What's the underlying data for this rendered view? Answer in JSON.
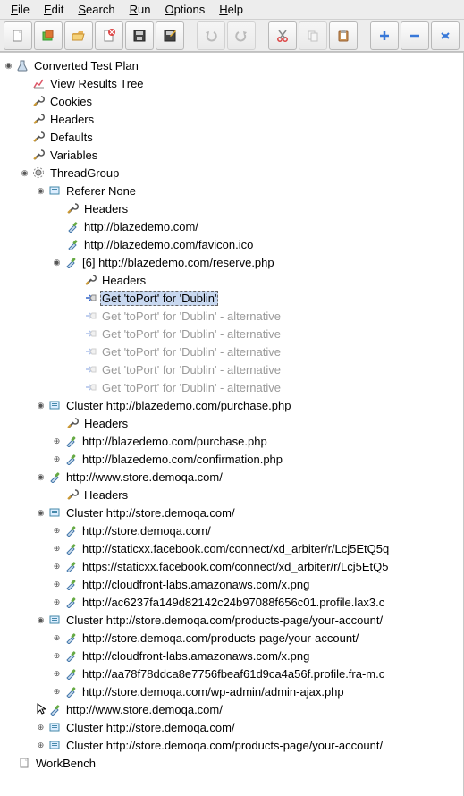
{
  "menu": {
    "file": "File",
    "edit": "Edit",
    "search": "Search",
    "run": "Run",
    "options": "Options",
    "help": "Help"
  },
  "toolbar": {
    "new": "new",
    "templates": "templates",
    "open": "open",
    "close": "close",
    "save": "save",
    "saveas": "save-as",
    "undo": "undo",
    "redo": "redo",
    "cut": "cut",
    "copy": "copy",
    "paste": "paste",
    "expand": "expand",
    "collapse": "collapse",
    "toggle": "toggle"
  },
  "tree": {
    "root": "Converted Test Plan",
    "viewResults": "View Results Tree",
    "cookies": "Cookies",
    "headers": "Headers",
    "defaults": "Defaults",
    "variables": "Variables",
    "threadGroup": "ThreadGroup",
    "refererNone": "Referer None",
    "refHeaders": "Headers",
    "req1": "http://blazedemo.com/",
    "req2": "http://blazedemo.com/favicon.ico",
    "req3": "[6] http://blazedemo.com/reserve.php",
    "req3Headers": "Headers",
    "selToPort": "Get 'toPort' for 'Dublin'",
    "altToPort": "Get 'toPort' for 'Dublin' - alternative",
    "cluster1": "Cluster http://blazedemo.com/purchase.php",
    "c1Headers": "Headers",
    "c1r1": "http://blazedemo.com/purchase.php",
    "c1r2": "http://blazedemo.com/confirmation.php",
    "wwwStore": "http://www.store.demoqa.com/",
    "wwwStoreHeaders": "Headers",
    "cluster2": "Cluster http://store.demoqa.com/",
    "c2r1": "http://store.demoqa.com/",
    "c2r2": "http://staticxx.facebook.com/connect/xd_arbiter/r/Lcj5EtQ5q",
    "c2r3": "https://staticxx.facebook.com/connect/xd_arbiter/r/Lcj5EtQ5",
    "c2r4": "http://cloudfront-labs.amazonaws.com/x.png",
    "c2r5": "http://ac6237fa149d82142c24b97088f656c01.profile.lax3.c",
    "cluster3": "Cluster http://store.demoqa.com/products-page/your-account/",
    "c3r1": "http://store.demoqa.com/products-page/your-account/",
    "c3r2": "http://cloudfront-labs.amazonaws.com/x.png",
    "c3r3": "http://aa78f78ddca8e7756fbeaf61d9ca4a56f.profile.fra-m.c",
    "c3r4": "http://store.demoqa.com/wp-admin/admin-ajax.php",
    "wwwStore2": "http://www.store.demoqa.com/",
    "cluster4": "Cluster http://store.demoqa.com/",
    "cluster5": "Cluster http://store.demoqa.com/products-page/your-account/",
    "workbench": "WorkBench"
  }
}
